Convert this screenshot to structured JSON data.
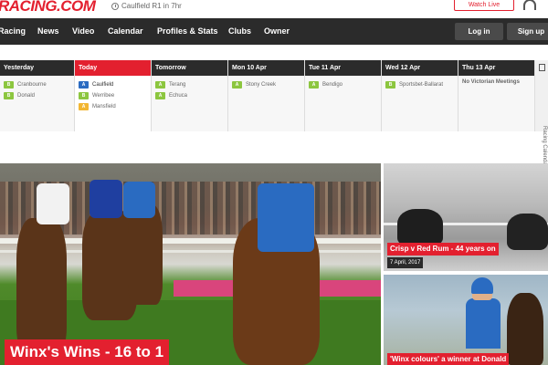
{
  "header": {
    "logo": "RACING.COM",
    "countdown": "Caulfield R1 in 7hr",
    "watch_live": "Watch Live",
    "headphones_icon": "headphones-icon"
  },
  "nav": {
    "items": [
      "Racing",
      "News",
      "Video",
      "Calendar",
      "Profiles & Stats",
      "Clubs",
      "Owner"
    ],
    "login": "Log in",
    "signup": "Sign up"
  },
  "calendar": {
    "side_label": "Racing Calendar",
    "days": [
      {
        "label": "Yesterday",
        "venues": [
          {
            "tag": "B",
            "name": "Cranbourne"
          },
          {
            "tag": "B",
            "name": "Donald"
          }
        ]
      },
      {
        "label": "Today",
        "venues": [
          {
            "tag": "A",
            "name": "Caulfield"
          },
          {
            "tag": "B",
            "name": "Werribee"
          },
          {
            "tag": "A",
            "name": "Mansfield"
          }
        ]
      },
      {
        "label": "Tomorrow",
        "venues": [
          {
            "tag": "A",
            "name": "Terang"
          },
          {
            "tag": "A",
            "name": "Echuca"
          }
        ]
      },
      {
        "label": "Mon 10 Apr",
        "venues": [
          {
            "tag": "A",
            "name": "Stony Creek"
          }
        ]
      },
      {
        "label": "Tue 11 Apr",
        "venues": [
          {
            "tag": "A",
            "name": "Bendigo"
          }
        ]
      },
      {
        "label": "Wed 12 Apr",
        "venues": [
          {
            "tag": "B",
            "name": "Sportsbet-Ballarat"
          }
        ]
      },
      {
        "label": "Thu 13 Apr",
        "note": "No Victorian Meetings",
        "venues": []
      }
    ]
  },
  "hero": {
    "caption": "Winx's Wins - 16 to 1"
  },
  "cards": [
    {
      "caption": "Crisp v Red Rum - 44 years on",
      "date": "7 April, 2017"
    },
    {
      "caption": "'Winx colours' a winner at Donald"
    }
  ],
  "colors": {
    "accent": "#e3202f",
    "nav_bg": "#2b2b2b",
    "tag_b": "#8cc63f",
    "tag_a": "#2a6bc1",
    "tag_y": "#f2b632"
  }
}
